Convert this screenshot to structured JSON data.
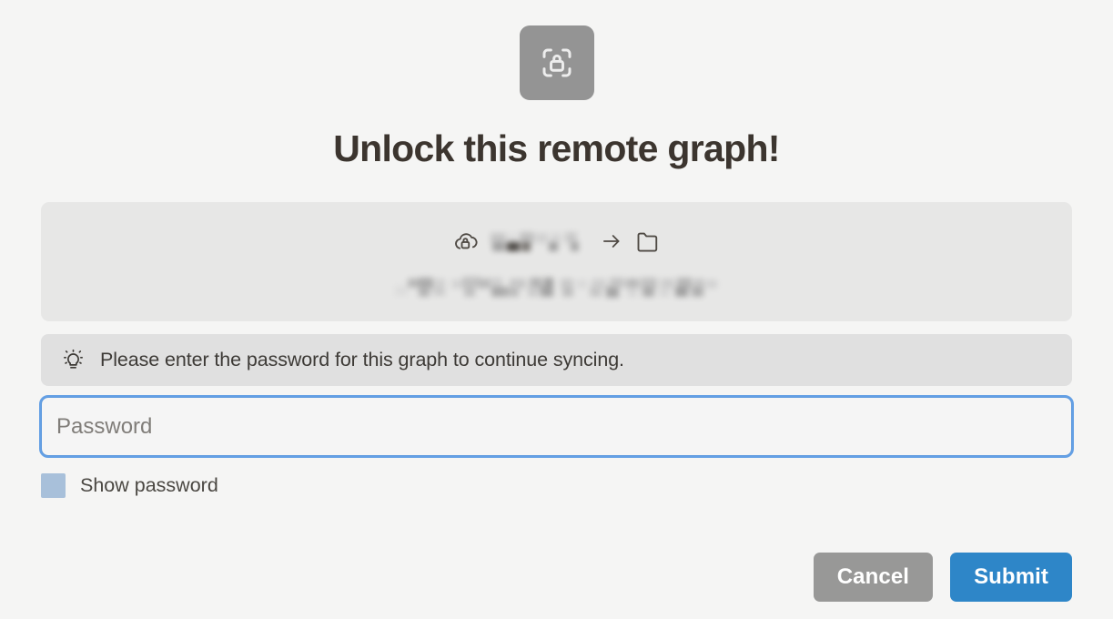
{
  "dialog": {
    "title": "Unlock this remote graph!",
    "header_icon": "scan-lock-icon"
  },
  "info_panel": {
    "source_icon": "cloud-lock-icon",
    "source_name_redacted": "██████",
    "arrow_icon": "arrow-right-icon",
    "target_icon": "folder-icon",
    "detail_line_redacted": "█████ ████ ██████ ███ ████████"
  },
  "hint": {
    "icon": "lightbulb-icon",
    "text": "Please enter the password for this graph to continue syncing."
  },
  "password_field": {
    "placeholder": "Password",
    "value": ""
  },
  "show_password": {
    "label": "Show password",
    "checked": false
  },
  "actions": {
    "cancel_label": "Cancel",
    "submit_label": "Submit"
  },
  "colors": {
    "page_background": "#f5f5f4",
    "panel_background": "#e7e7e6",
    "hint_background": "#e0e0e0",
    "badge_background": "#949494",
    "focus_ring": "#4a90e2",
    "checkbox": "#a8c0da",
    "cancel_button": "#989897",
    "submit_button": "#2e86c8",
    "title_text": "#3c352f"
  }
}
